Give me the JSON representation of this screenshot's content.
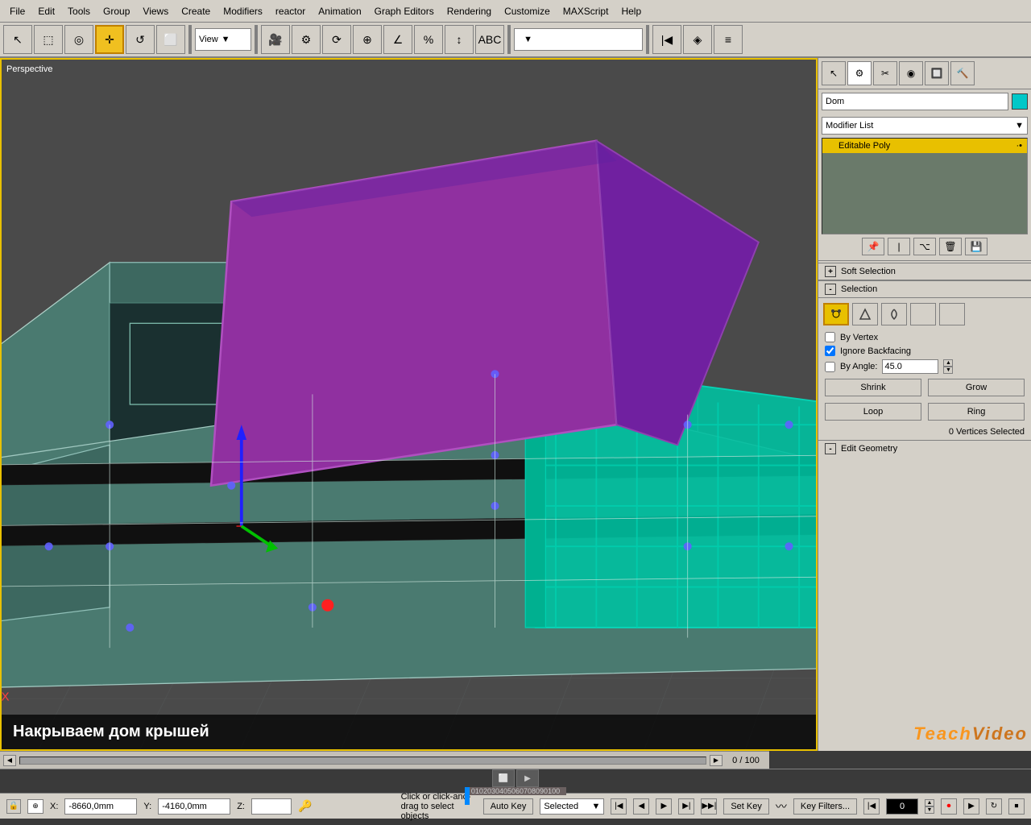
{
  "menu": {
    "items": [
      "File",
      "Edit",
      "Tools",
      "Group",
      "Views",
      "Create",
      "Modifiers",
      "reactor",
      "Animation",
      "Graph Editors",
      "Rendering",
      "Customize",
      "MAXScript",
      "Help"
    ]
  },
  "toolbar": {
    "view_label": "View",
    "view_dropdown_arrow": "▼"
  },
  "viewport": {
    "label": "Perspective"
  },
  "subtitle": {
    "text": "Накрываем дом крышей"
  },
  "right_panel": {
    "object_name": "Dom",
    "modifier_list_label": "Modifier List",
    "modifier_list_arrow": "▼",
    "editable_poly_label": "Editable Poly",
    "soft_selection_label": "Soft Selection",
    "selection_label": "Selection",
    "by_vertex_label": "By Vertex",
    "ignore_backfacing_label": "Ignore Backfacing",
    "by_angle_label": "By Angle:",
    "by_angle_value": "45.0",
    "shrink_label": "Shrink",
    "grow_label": "Grow",
    "vertices_selected": "0 Vertices Selected",
    "edit_geometry_label": "Edit Geometry"
  },
  "timeline": {
    "frame_counter": "0 / 100",
    "ticks": [
      "0",
      "10",
      "20",
      "30",
      "40",
      "50",
      "60",
      "70",
      "80",
      "90",
      "100"
    ]
  },
  "status_bar": {
    "x_label": "X:",
    "x_value": "-8660,0mm",
    "y_label": "Y:",
    "y_value": "-4160,0mm",
    "z_label": "Z:",
    "z_value": "",
    "auto_key_label": "Auto Key",
    "selected_label": "Selected",
    "set_key_label": "Set Key",
    "key_filters_label": "Key Filters...",
    "frame_value": "0",
    "message": "Click or click-and-drag to select objects"
  },
  "watermark": {
    "line1": "Teach",
    "line2": "Video"
  },
  "icons": {
    "select": "↖",
    "region": "⬚",
    "circle": "◎",
    "move": "✛",
    "rotate": "↺",
    "scale": "⬜",
    "undo": "↩",
    "redo": "↪",
    "select_dot": "·*",
    "arc": "◁",
    "lasso": "⌒",
    "poly_sq": "■",
    "poly_dot": "●",
    "shrink_icon": "◇",
    "grow_icon": "◇"
  }
}
